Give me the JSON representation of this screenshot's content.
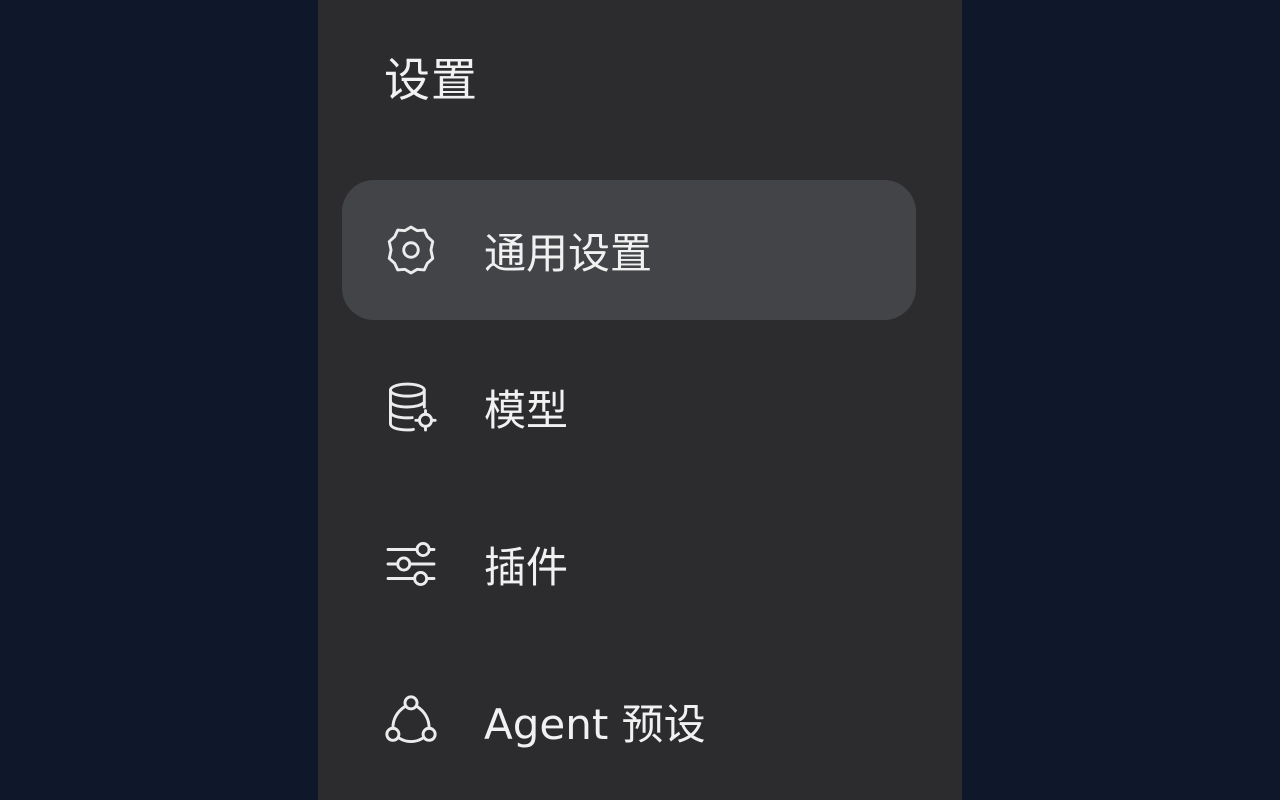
{
  "panel": {
    "title": "设置"
  },
  "menu": {
    "items": [
      {
        "label": "通用设置",
        "icon": "gear-icon",
        "active": true
      },
      {
        "label": "模型",
        "icon": "database-settings-icon",
        "active": false
      },
      {
        "label": "插件",
        "icon": "sliders-icon",
        "active": false
      },
      {
        "label": "Agent 预设",
        "icon": "agent-share-icon",
        "active": false
      }
    ]
  },
  "colors": {
    "background": "#0f182b",
    "panel": "#2c2c2e",
    "active_item": "#434448",
    "text": "#f1f1f1"
  }
}
